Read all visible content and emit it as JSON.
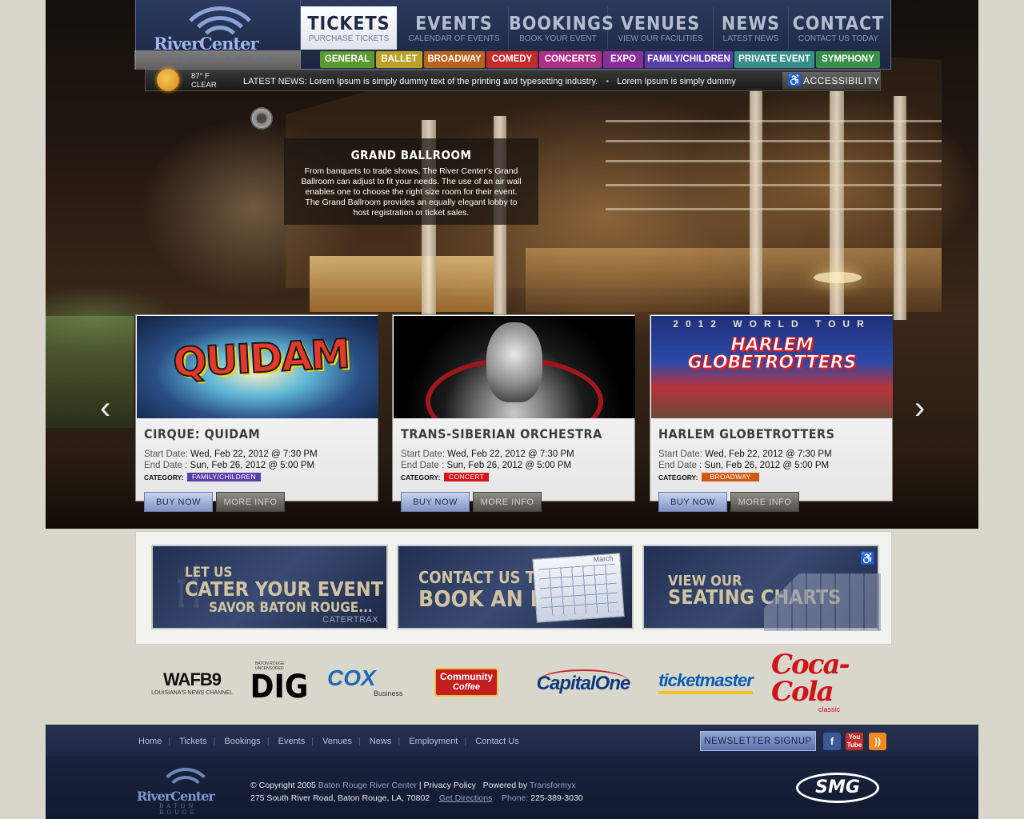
{
  "logo": {
    "name": "RiverCenter",
    "city": "BATON ROUGE"
  },
  "nav": [
    {
      "title": "TICKETS",
      "sub": "PURCHASE TICKETS"
    },
    {
      "title": "EVENTS",
      "sub": "CALENDAR OF EVENTS"
    },
    {
      "title": "BOOKINGS",
      "sub": "BOOK YOUR EVENT"
    },
    {
      "title": "VENUES",
      "sub": "VIEW OUR FACILITIES"
    },
    {
      "title": "NEWS",
      "sub": "LATEST NEWS"
    },
    {
      "title": "CONTACT",
      "sub": "CONTACT US TODAY"
    }
  ],
  "categories": [
    {
      "label": "GENERAL",
      "color": "#5a9a2e"
    },
    {
      "label": "BALLET",
      "color": "#b9a226"
    },
    {
      "label": "BROADWAY",
      "color": "#b8621d"
    },
    {
      "label": "COMEDY",
      "color": "#c42b2b"
    },
    {
      "label": "CONCERTS",
      "color": "#b02f87"
    },
    {
      "label": "EXPO",
      "color": "#8a2f9a"
    },
    {
      "label": "FAMILY/CHILDREN",
      "color": "#5a3ea8"
    },
    {
      "label": "PRIVATE EVENT",
      "color": "#3a8e8a"
    },
    {
      "label": "SYMPHONY",
      "color": "#3a8e4a"
    }
  ],
  "weather": {
    "temp": "87° F",
    "condition": "CLEAR"
  },
  "ticker": {
    "label": "LATEST NEWS:",
    "item1": "Lorem Ipsum is simply dummy text of the printing and typesetting industry.",
    "item2": "Lorem Ipsum is simply dummy"
  },
  "accessibility": "ACCESSIBILITY",
  "feature": {
    "title": "GRAND BALLROOM",
    "text": "From banquets to trade shows, The River Center's Grand Ballroom can adjust to fit your needs. The use of an air wall enables one to choose the right size room for their event. The Grand Ballroom provides an equally elegant lobby to host registration or ticket sales."
  },
  "events": [
    {
      "title": "CIRQUE: QUIDAM",
      "art": "QUIDAM",
      "start_label": "Start Date:",
      "start": "Wed, Feb 22, 2012 @ 7:30 PM",
      "end_label": "End Date :",
      "end": "Sun, Feb 26, 2012 @ 5:00 PM",
      "category_label": "CATEGORY:",
      "category": "FAMILY/CHILDREN",
      "category_color": "#5a3ea8",
      "buy": "BUY NOW",
      "more": "MORE INFO"
    },
    {
      "title": "TRANS-SIBERIAN ORCHESTRA",
      "art": "",
      "start_label": "Start Date:",
      "start": "Wed, Feb 22, 2012 @ 7:30 PM",
      "end_label": "End Date :",
      "end": "Sun, Feb 26, 2012 @ 5:00 PM",
      "category_label": "CATEGORY:",
      "category": "CONCERT",
      "category_color": "#d1161c",
      "buy": "BUY NOW",
      "more": "MORE INFO"
    },
    {
      "title": "HARLEM GLOBETROTTERS",
      "art": "HARLEM GLOBETROTTERS",
      "art_top": "2012 WORLD TOUR",
      "start_label": "Start Date:",
      "start": "Wed, Feb 22, 2012 @ 7:30 PM",
      "end_label": "End Date :",
      "end": "Sun, Feb 26, 2012 @ 5:00 PM",
      "category_label": "CATEGORY:",
      "category": "BROADWAY",
      "category_color": "#d05a14",
      "buy": "BUY NOW",
      "more": "MORE INFO"
    }
  ],
  "promos": [
    {
      "line1": "LET US",
      "line2": "CATER YOUR EVENT",
      "line3": "SAVOR BATON ROUGE...",
      "brand": "CATERTRAX"
    },
    {
      "line1": "CONTACT US TO",
      "line2": "BOOK AN EVENT",
      "calendar": "March"
    },
    {
      "line1": "VIEW OUR",
      "line2": "SEATING CHARTS"
    }
  ],
  "sponsors": [
    {
      "name": "WAFB9",
      "sub": "LOUISIANA'S NEWS CHANNEL"
    },
    {
      "name": "DIG",
      "sub": "BATON ROUGE UNCENSORED"
    },
    {
      "name": "COX",
      "sub": "Business"
    },
    {
      "name": "Community",
      "sub": "Coffee"
    },
    {
      "name": "CapitalOne",
      "sub": ""
    },
    {
      "name": "ticketmaster",
      "sub": ""
    },
    {
      "name": "Coca-Cola",
      "sub": "classic"
    }
  ],
  "footer": {
    "links": [
      "Home",
      "Tickets",
      "Bookings",
      "Events",
      "Venues",
      "News",
      "Employment",
      "Contact Us"
    ],
    "newsletter": "NEWSLETTER SIGNUP",
    "copyright": "© Copyright 2005",
    "org": "Baton Rouge River Center",
    "privacy": "Privacy Policy",
    "powered_label": "Powered by",
    "powered": "Transformyx",
    "address": "275 South River Road, Baton Rouge, LA, 70802",
    "directions": "Get Directions",
    "phone_label": "Phone:",
    "phone": "225-389-3030",
    "smg": "SMG"
  }
}
